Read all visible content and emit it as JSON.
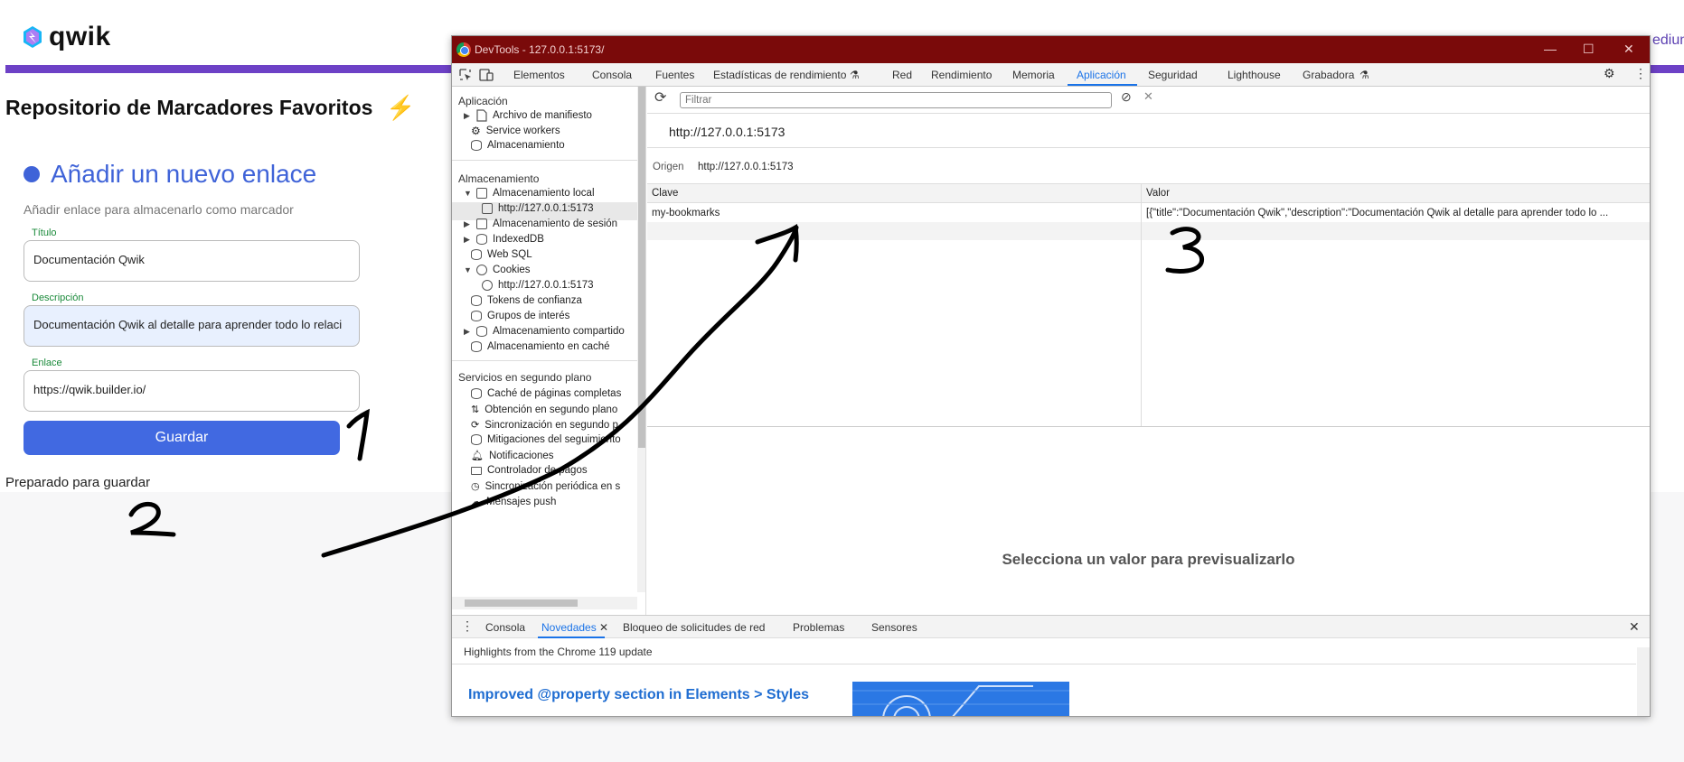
{
  "app": {
    "logo_text": "qwik",
    "cut_text": "edium",
    "page_title": "Repositorio de Marcadores Favoritos",
    "title_emoji": "⚡",
    "card_title": "Añadir un nuevo enlace",
    "card_subtitle": "Añadir enlace para almacenarlo como marcador",
    "fields": [
      {
        "label": "Título",
        "value": "Documentación Qwik"
      },
      {
        "label": "Descripción",
        "value": "Documentación Qwik al detalle para aprender todo lo relaci"
      },
      {
        "label": "Enlace",
        "value": "https://qwik.builder.io/"
      }
    ],
    "save_label": "Guardar",
    "status": "Preparado para guardar"
  },
  "devtools": {
    "window_title": "DevTools - 127.0.0.1:5173/",
    "window_buttons": [
      "—",
      "☐",
      "✕"
    ],
    "tabs": [
      "Elementos",
      "Consola",
      "Fuentes",
      "Estadísticas de rendimiento",
      "Red",
      "Rendimiento",
      "Memoria",
      "Aplicación",
      "Seguridad",
      "Lighthouse",
      "Grabadora"
    ],
    "active_tab": "Aplicación",
    "sidebar": {
      "section_app": "Aplicación",
      "app_items": [
        "Archivo de manifiesto",
        "Service workers",
        "Almacenamiento"
      ],
      "section_storage": "Almacenamiento",
      "storage_items": [
        "Almacenamiento local",
        "http://127.0.0.1:5173",
        "Almacenamiento de sesión",
        "IndexedDB",
        "Web SQL",
        "Cookies",
        "http://127.0.0.1:5173",
        "Tokens de confianza",
        "Grupos de interés",
        "Almacenamiento compartido",
        "Almacenamiento en caché"
      ],
      "section_bg": "Servicios en segundo plano",
      "bg_items": [
        "Caché de páginas completas",
        "Obtención en segundo plano",
        "Sincronización en segundo p",
        "Mitigaciones del seguimiento",
        "Notificaciones",
        "Controlador de pagos",
        "Sincronización periódica en s",
        "Mensajes push"
      ]
    },
    "filter_placeholder": "Filtrar",
    "origin_url": "http://127.0.0.1:5173",
    "origin_label": "Origen",
    "origin_value": "http://127.0.0.1:5173",
    "table": {
      "col_key": "Clave",
      "col_value": "Valor",
      "row_key": "my-bookmarks",
      "row_value": "[{\"title\":\"Documentación Qwik\",\"description\":\"Documentación Qwik al detalle para aprender todo lo ..."
    },
    "preview_text": "Selecciona un valor para previsualizarlo",
    "drawer_tabs": [
      "Consola",
      "Novedades",
      "Bloqueo de solicitudes de red",
      "Problemas",
      "Sensores"
    ],
    "drawer_active": "Novedades",
    "highlights": "Highlights from the Chrome 119 update",
    "improved_title": "Improved @property section in Elements > Styles"
  },
  "annotations": [
    "1",
    "2",
    "3"
  ]
}
